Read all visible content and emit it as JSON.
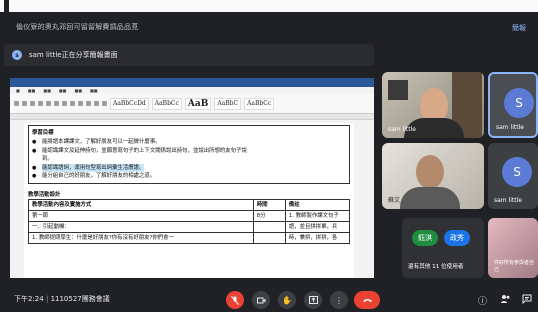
{
  "meeting": {
    "title": "倫仪寮的奧丸邓回可留留解費調品品莧",
    "top_right_link": "簡報",
    "presenting_text": "sam little正在分享簡報畫面",
    "time": "下午2:24",
    "code": "1110527團務會議"
  },
  "document": {
    "ribbon_styles": [
      "AaBbCcDd",
      "AaBbCc",
      "AaB",
      "AaBbC",
      "AaBbCc"
    ],
    "goal_head": "學習目標",
    "goals": [
      "能將語本課課文，了解好朋友可以一起做什麼事。",
      "能認識課文及延伸詩句，並願意寫句子的上下文關係說出詩句，並說出所想的友句子說",
      "到。",
      "能認識語詞，運用句型寫出詞彙生活應證。",
      "能分組自己的好朋友，了解好朋友的相處之道。"
    ],
    "design_head": "教學活動設計",
    "table_headers": [
      "教學活動內容及實施方式",
      "時間",
      "備註"
    ],
    "rows": [
      [
        "第一節",
        "8分",
        "1. 教師製作課文句子"
      ],
      [
        "一、引起動機：",
        "",
        "語，並且拼拼單，兵"
      ],
      [
        "1. 教師提問學生：什麼是好朋友?你有沒有好朋友?你們會一",
        "",
        "時，兼拼，拼拼，各"
      ]
    ]
  },
  "participants": [
    {
      "name": "sam little",
      "initial": "S"
    },
    {
      "name": "sam little",
      "initial": "S"
    },
    {
      "name": "蘇文",
      "initial": ""
    },
    {
      "name": "sam little",
      "initial": "S"
    },
    {
      "name": "還有其他 11 位使用者",
      "initial": ""
    },
    {
      "name": "你好所有参與者自己",
      "initial": ""
    }
  ],
  "badges": [
    {
      "label": "鈺淇",
      "color": "#1e8e3e"
    },
    {
      "label": "政秀",
      "color": "#1a73e8"
    }
  ],
  "controls": {
    "mic": "mic-off",
    "cam": "camera",
    "hand": "raise-hand",
    "present": "present",
    "more": "more",
    "end": "end-call"
  },
  "colors": {
    "accent": "#8ab4f8",
    "end": "#ea4335"
  }
}
